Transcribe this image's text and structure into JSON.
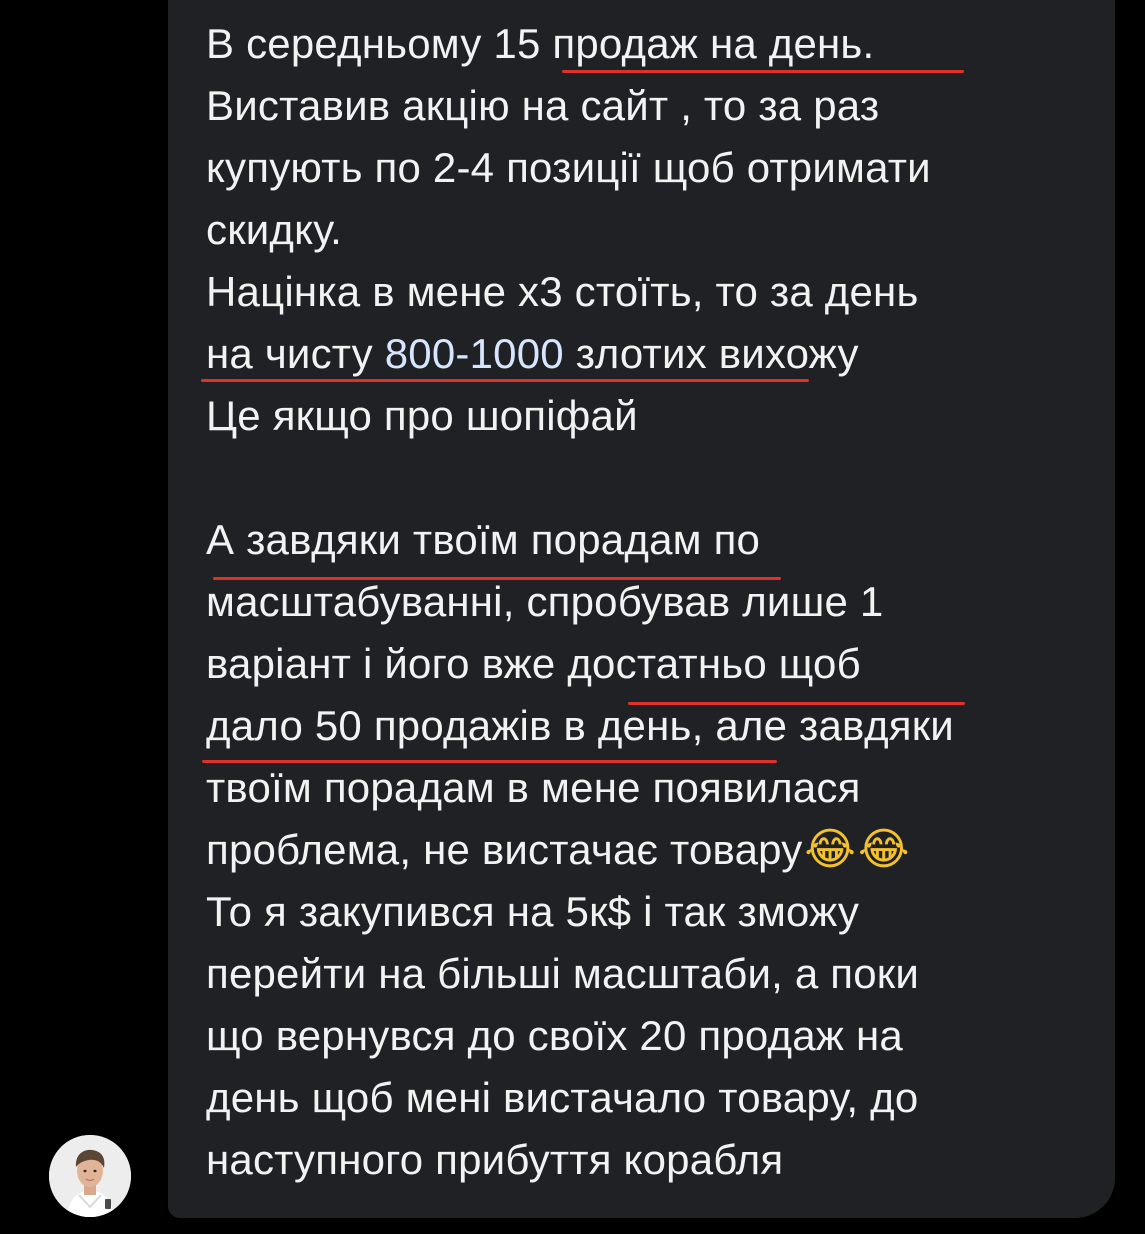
{
  "chat": {
    "message": {
      "lines": [
        "В середньому 15 продаж на день.",
        "Виставив акцію на сайт , то за раз",
        "купують по 2-4 позиції щоб отримати",
        "скидку.",
        "Націнка в мене х3 стоїть, то за день",
        "на чисту ",
        "800-1000",
        " злотих вихожу",
        "Це якщо про шопіфай",
        "А завдяки твоїм порадам по",
        "масштабуванні, спробував лише 1",
        "варіант і його вже достатньо щоб",
        "дало 50 продажів в день, але завдяки",
        "твоїм порадам в мене появилася",
        "проблема, не вистачає товару",
        "То я закупився на 5к$ і так зможу",
        "перейти на більші масштаби, а поки",
        "що вернувся до своїх 20 продаж на",
        "день щоб мені вистачало товару, до",
        "наступного прибуття корабля"
      ],
      "emojis": [
        "😂",
        "😂"
      ]
    }
  },
  "colors": {
    "background": "#000000",
    "bubble": "#202124",
    "text": "#f2f2f2",
    "highlight_number": "#d7e6ff",
    "annotation_underline": "#e0302a"
  },
  "icons": {
    "avatar": "user-photo-avatar",
    "emoji": "face-with-tears-of-joy"
  }
}
